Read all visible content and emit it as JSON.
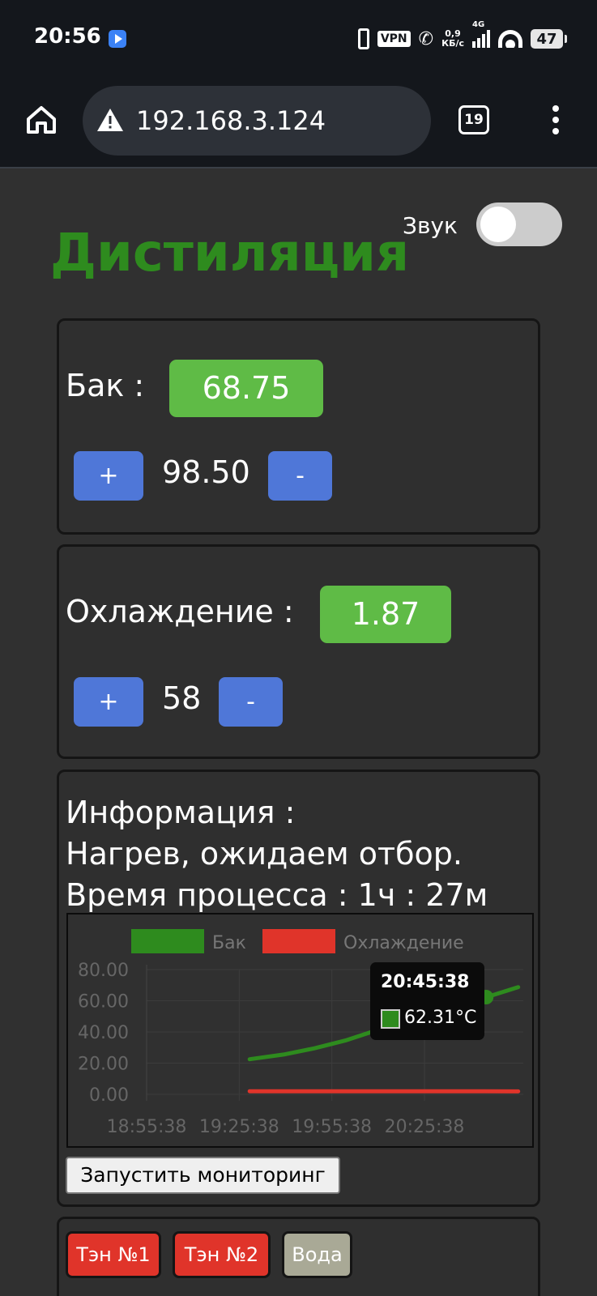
{
  "status_bar": {
    "time": "20:56",
    "vpn_label": "VPN",
    "net_speed_value": "0,9",
    "net_speed_unit": "КБ/с",
    "network_type": "4G",
    "battery": "47"
  },
  "browser": {
    "url": "192.168.3.124",
    "tab_count": "19"
  },
  "header": {
    "title": "Дистиляция",
    "sound_label": "Звук",
    "sound_enabled": false
  },
  "tank": {
    "label": "Бак :",
    "value": "68.75",
    "setpoint": "98.50",
    "plus_label": "+",
    "minus_label": "-"
  },
  "cooling": {
    "label": "Охлаждение :",
    "value": "1.87",
    "setpoint": "58",
    "plus_label": "+",
    "minus_label": "-"
  },
  "info": {
    "heading": "Информация :",
    "status": "Нагрев, ожидаем отбор.",
    "process_time": "Время процесса : 1ч : 27м"
  },
  "chart_data": {
    "type": "line",
    "legend": [
      "Бак",
      "Охлаждение"
    ],
    "y_ticks": [
      "80.00",
      "60.00",
      "40.00",
      "20.00",
      "0.00"
    ],
    "x_ticks": [
      "18:55:38",
      "19:25:38",
      "19:55:38",
      "20:25:38"
    ],
    "ylim": [
      0,
      80
    ],
    "series": [
      {
        "name": "Бак",
        "color": "#2e8b1e",
        "x": [
          "19:29:00",
          "19:40:00",
          "19:50:00",
          "20:00:00",
          "20:10:00",
          "20:20:00",
          "20:30:00",
          "20:38:00",
          "20:45:38",
          "20:56:00"
        ],
        "values": [
          22.5,
          25.5,
          29.5,
          34.5,
          41,
          49,
          56,
          60,
          62.31,
          68.75
        ]
      },
      {
        "name": "Охлаждение",
        "color": "#e0342a",
        "x": [
          "19:29:00",
          "19:45:00",
          "20:00:00",
          "20:15:00",
          "20:30:00",
          "20:45:00",
          "20:56:00"
        ],
        "values": [
          2.0,
          1.9,
          1.9,
          1.9,
          1.9,
          1.9,
          1.87
        ]
      }
    ],
    "tooltip": {
      "time": "20:45:38",
      "value": "62.31°C"
    }
  },
  "monitoring_button": "Запустить мониторинг",
  "controls": {
    "heater1": "Тэн №1",
    "heater2": "Тэн №2",
    "water": "Вода"
  }
}
